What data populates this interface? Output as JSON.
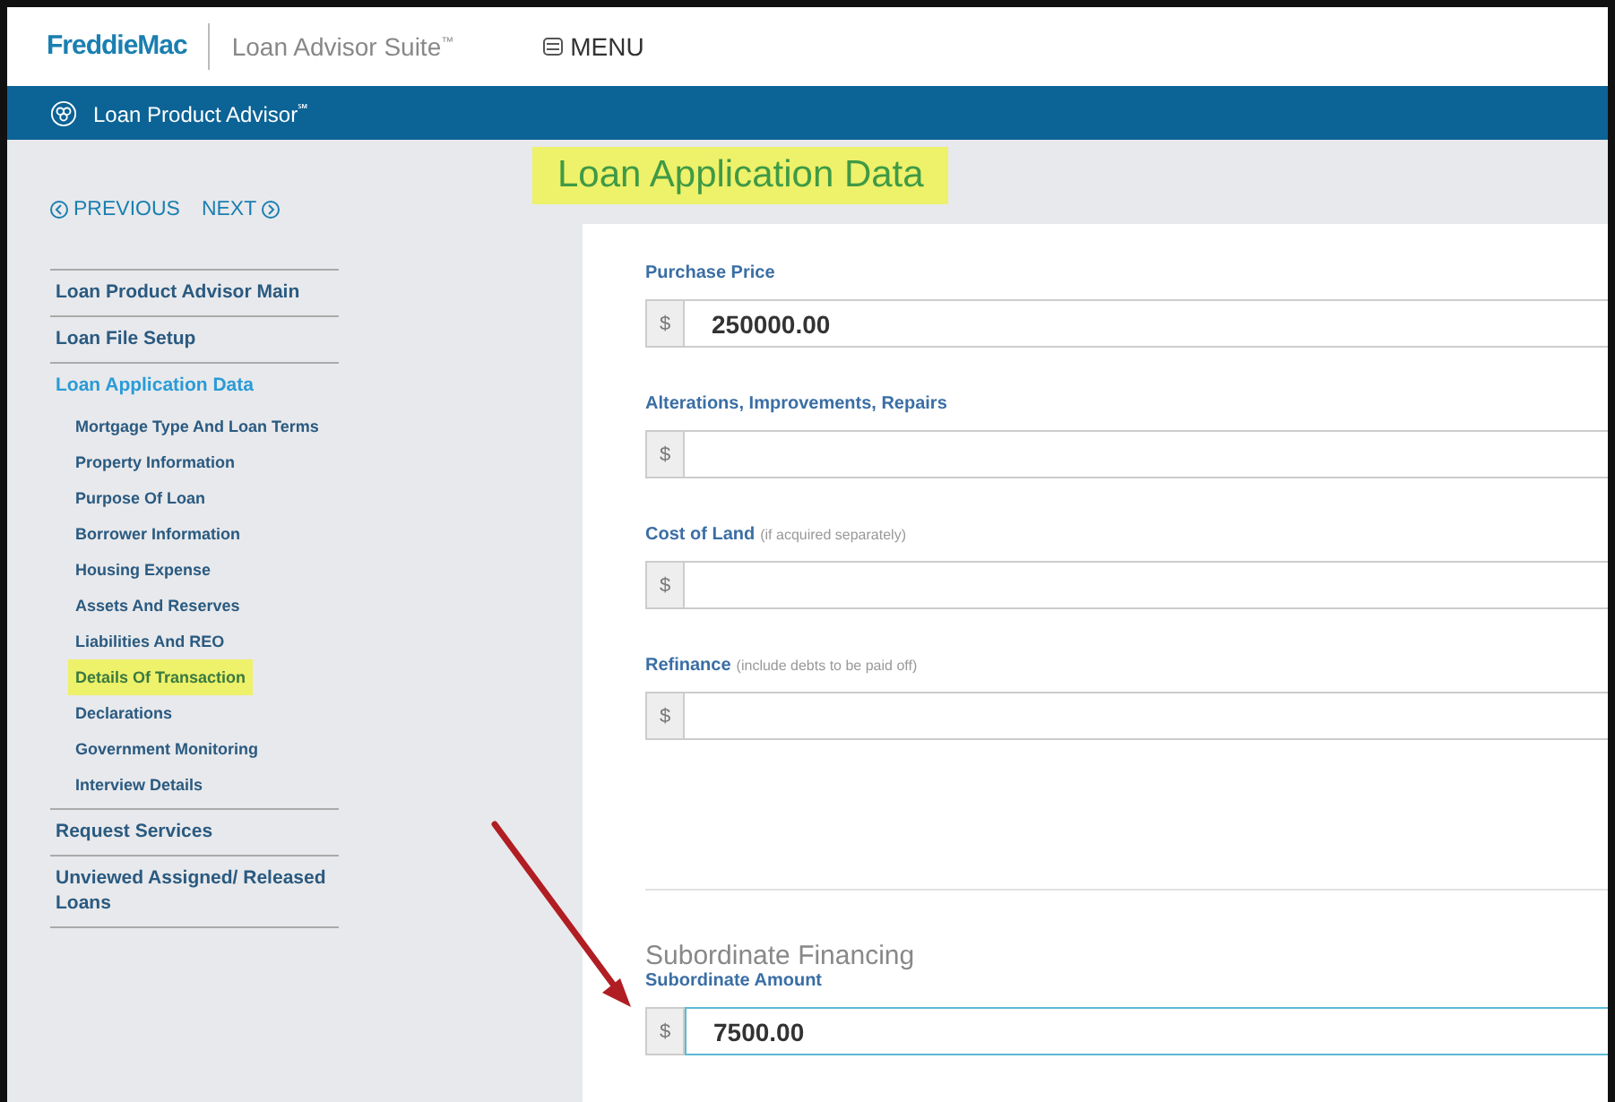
{
  "header": {
    "brand": "FreddieMac",
    "product": "Loan Advisor Suite",
    "trademark": "™",
    "menu": "MENU"
  },
  "app_bar": {
    "title": "Loan Product Advisor",
    "mark": "℠"
  },
  "nav": {
    "previous": "PREVIOUS",
    "next": "NEXT"
  },
  "page_title": {
    "text": "Loan Application Data",
    "highlighted": true
  },
  "sidebar": {
    "items": [
      {
        "label": "Loan Product Advisor Main",
        "selected": false
      },
      {
        "label": "Loan File Setup",
        "selected": false
      },
      {
        "label": "Loan Application Data",
        "selected": true,
        "children": [
          {
            "label": "Mortgage Type And Loan Terms",
            "highlighted": false
          },
          {
            "label": "Property Information",
            "highlighted": false
          },
          {
            "label": "Purpose Of Loan",
            "highlighted": false
          },
          {
            "label": "Borrower Information",
            "highlighted": false
          },
          {
            "label": "Housing Expense",
            "highlighted": false
          },
          {
            "label": "Assets And Reserves",
            "highlighted": false
          },
          {
            "label": "Liabilities And REO",
            "highlighted": false
          },
          {
            "label": "Details Of Transaction",
            "highlighted": true
          },
          {
            "label": "Declarations",
            "highlighted": false
          },
          {
            "label": "Government Monitoring",
            "highlighted": false
          },
          {
            "label": "Interview Details",
            "highlighted": false
          }
        ]
      },
      {
        "label": "Request Services",
        "selected": false
      },
      {
        "label": "Unviewed Assigned/ Released Loans",
        "selected": false
      }
    ]
  },
  "fields": [
    {
      "label": "Purchase Price",
      "prefix": "$",
      "value": "250000.00",
      "focused": false
    },
    {
      "label": "Alterations, Improvements, Repairs",
      "prefix": "$",
      "focused": false
    },
    {
      "label": "Cost of Land",
      "hint": "(if acquired separately)",
      "prefix": "$",
      "focused": false
    },
    {
      "label": "Refinance",
      "hint": "(include debts to be paid off)",
      "prefix": "$",
      "focused": false
    }
  ],
  "section": {
    "heading": "Subordinate Financing",
    "fields": [
      {
        "label": "Subordinate Amount",
        "prefix": "$",
        "value": "7500.00",
        "focused": true
      }
    ]
  }
}
